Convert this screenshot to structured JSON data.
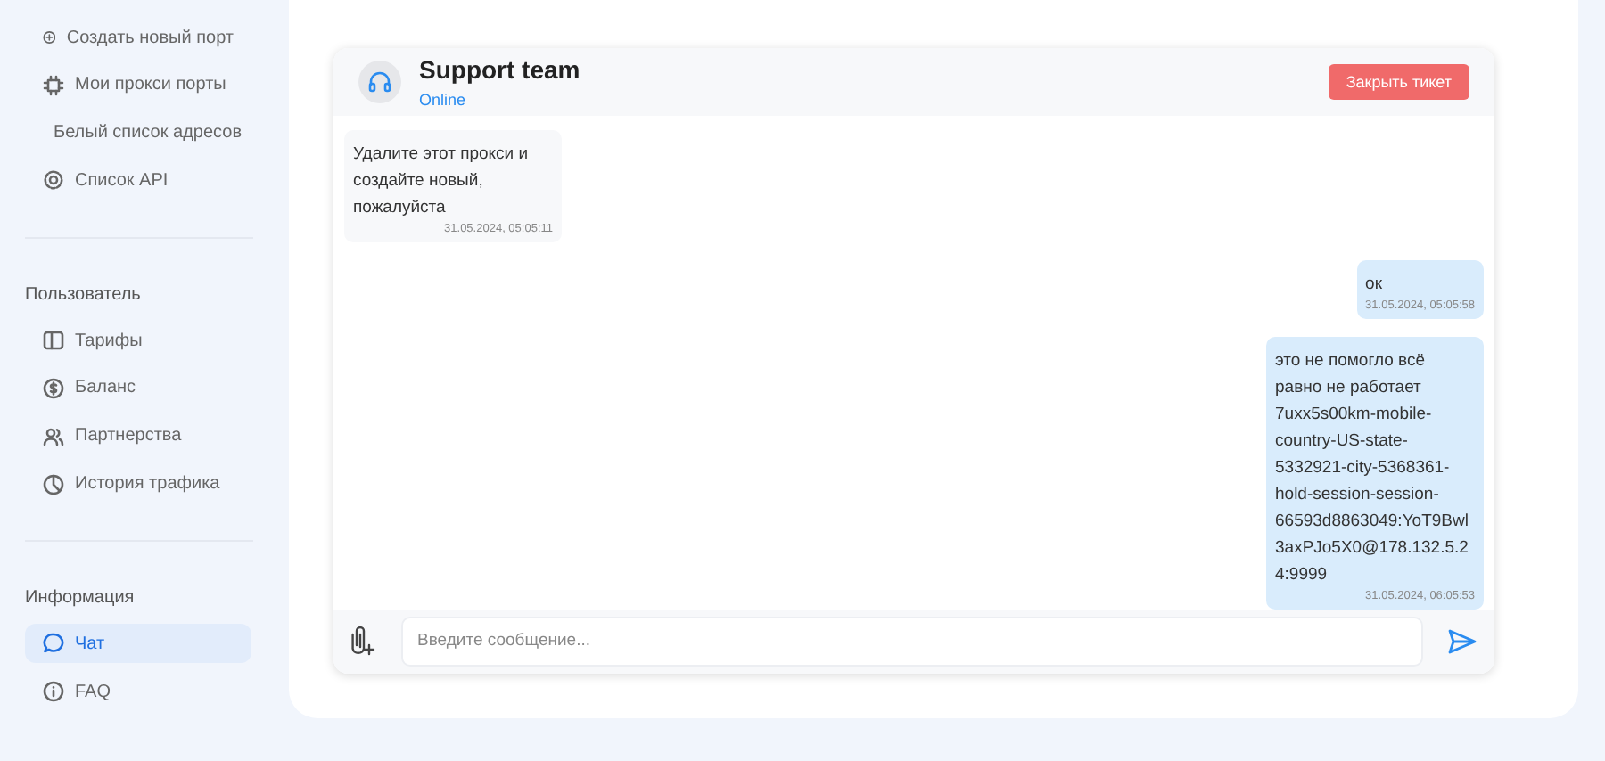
{
  "sidebar": {
    "sections": [
      {
        "items": [
          {
            "label": "Создать новый порт",
            "selected": false
          },
          {
            "label": "Мои прокси порты",
            "selected": false
          },
          {
            "label": "Белый список адресов",
            "selected": false
          },
          {
            "label": "Список API",
            "selected": false
          }
        ]
      },
      {
        "heading": "Пользователь",
        "items": [
          {
            "label": "Тарифы",
            "selected": false
          },
          {
            "label": "Баланс",
            "selected": false
          },
          {
            "label": "Партнерства",
            "selected": false
          },
          {
            "label": "История трафика",
            "selected": false
          }
        ]
      },
      {
        "heading": "Информация",
        "items": [
          {
            "label": "Чат",
            "selected": true
          },
          {
            "label": "FAQ",
            "selected": false
          }
        ]
      }
    ]
  },
  "chat": {
    "header": {
      "name": "Support team",
      "status": "Online",
      "close_button": "Закрыть тикет"
    },
    "messages": [
      {
        "kind": "incoming",
        "text": "Удалите этот прокси и создайте новый, пожалуйста",
        "time": "31.05.2024, 05:05:11"
      },
      {
        "kind": "outgoing",
        "text": "ок",
        "time": "31.05.2024, 05:05:58"
      },
      {
        "kind": "outgoing",
        "text": "это не помогло всё равно не работает 7uxx5s00km-mobile-country-US-state-5332921-city-5368361-hold-session-session-66593d8863049:YoT9Bwl3axPJo5X0@178.132.5.24:9999",
        "time": "31.05.2024, 06:05:53"
      }
    ],
    "input": {
      "placeholder": "Введите сообщение..."
    }
  }
}
